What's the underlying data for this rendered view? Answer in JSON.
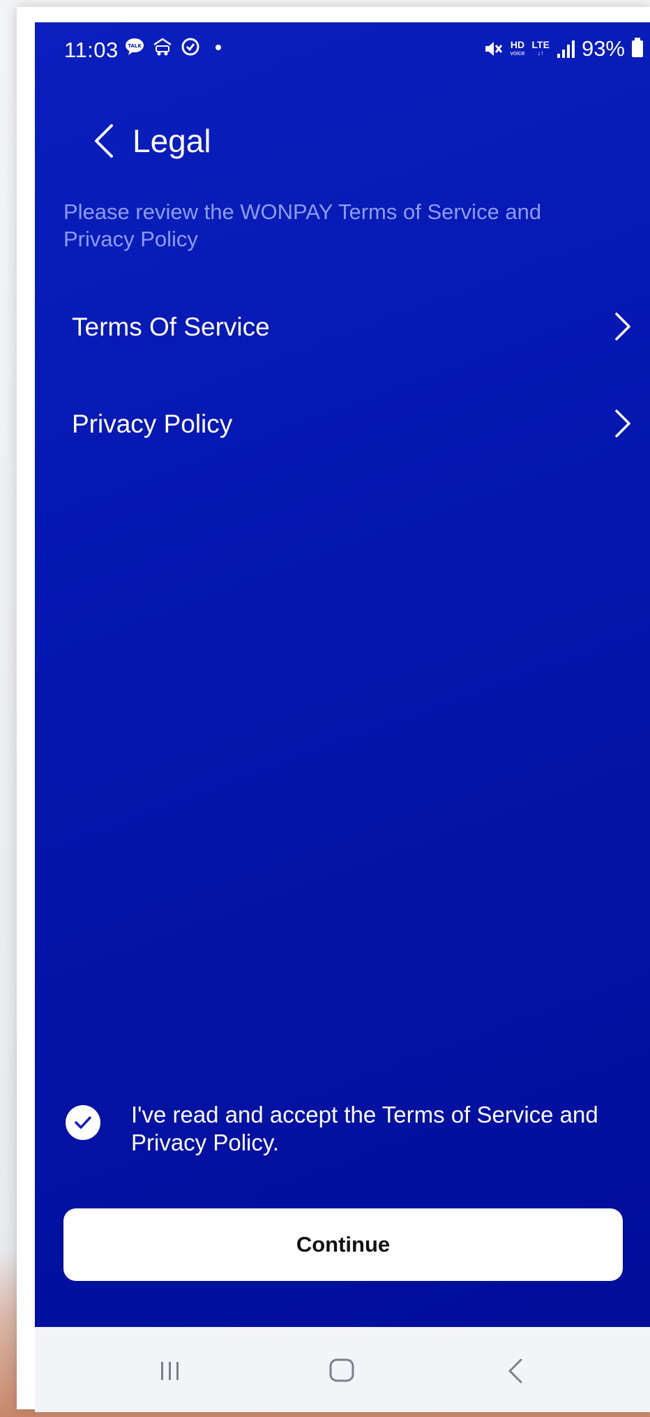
{
  "status_bar": {
    "time": "11:03",
    "battery": "93%",
    "left_icons": [
      "talk-icon",
      "car-icon",
      "target-icon",
      "dot-icon"
    ],
    "right_icons": [
      "mute-icon",
      "hd-voice-icon",
      "lte-icon",
      "signal-icon",
      "battery-icon"
    ],
    "hd_label": "HD",
    "hd_sub": "voice",
    "lte_label": "LTE"
  },
  "header": {
    "title": "Legal",
    "subtitle": "Please review the WONPAY Terms of Service and Privacy Policy"
  },
  "list": {
    "items": [
      {
        "label": "Terms Of Service"
      },
      {
        "label": "Privacy Policy"
      }
    ]
  },
  "accept": {
    "checked": true,
    "text": "I've read and accept the Terms of Service and Privacy Policy."
  },
  "continue": {
    "label": "Continue"
  },
  "navbar": {
    "items": [
      "recent-apps-icon",
      "home-icon",
      "back-icon"
    ]
  },
  "colors": {
    "background_top": "#0a1fbe",
    "background_bottom": "#000e99",
    "subtitle": "#8e9cf0",
    "button": "#ffffff",
    "checkmark": "#0a1fbe"
  }
}
